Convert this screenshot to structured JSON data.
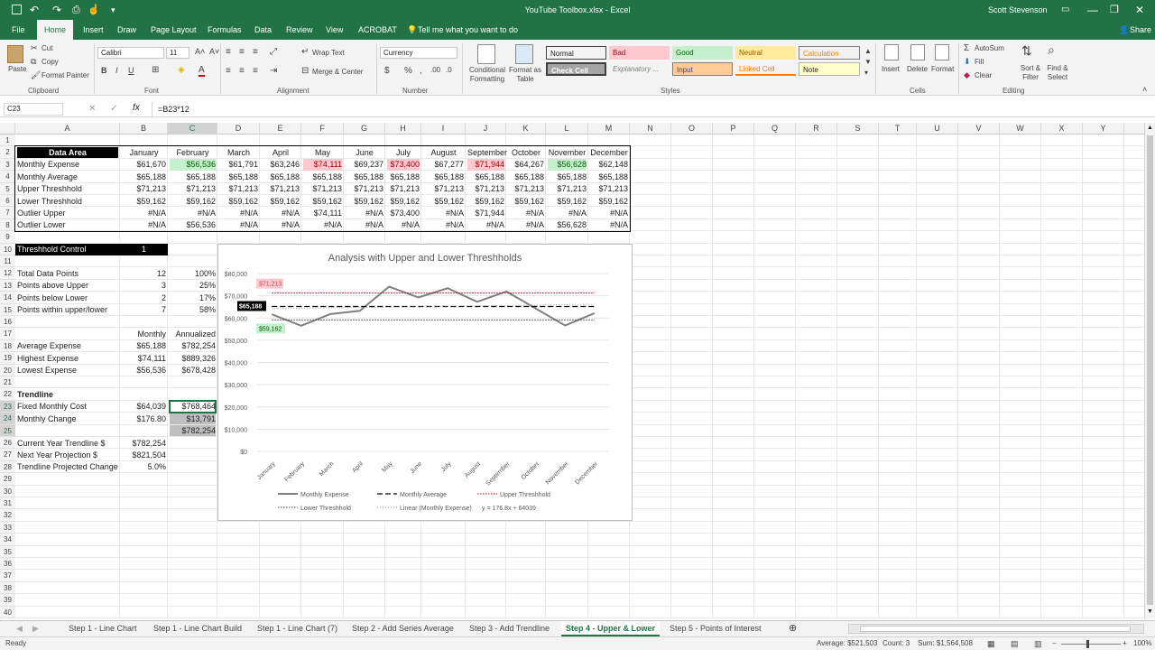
{
  "window": {
    "title": "YouTube Toolbox.xlsx - Excel",
    "user": "Scott Stevenson",
    "share": "Share"
  },
  "menu": [
    "File",
    "Home",
    "Insert",
    "Draw",
    "Page Layout",
    "Formulas",
    "Data",
    "Review",
    "View",
    "ACROBAT"
  ],
  "tellme": "Tell me what you want to do",
  "ribbon": {
    "paste": "Paste",
    "cut": "Cut",
    "copy": "Copy",
    "format_painter": "Format Painter",
    "font_name": "Calibri",
    "font_size": "11",
    "wrap_text": "Wrap Text",
    "merge_center": "Merge & Center",
    "number_format": "Currency",
    "cond_format": "Conditional Formatting",
    "format_table": "Format as Table",
    "styles": [
      {
        "label": "Normal",
        "bg": "#ffffff",
        "fg": "#222222"
      },
      {
        "label": "Bad",
        "bg": "#ffc7ce",
        "fg": "#9c0006"
      },
      {
        "label": "Good",
        "bg": "#c6efce",
        "fg": "#006100"
      },
      {
        "label": "Neutral",
        "bg": "#ffeb9c",
        "fg": "#9c5700"
      },
      {
        "label": "Calculation",
        "bg": "#f2f2f2",
        "fg": "#fa7d00"
      },
      {
        "label": "Check Cell",
        "bg": "#a5a5a5",
        "fg": "#ffffff"
      },
      {
        "label": "Explanatory ...",
        "bg": "#ffffff",
        "fg": "#7f7f7f"
      },
      {
        "label": "Input",
        "bg": "#ffcc99",
        "fg": "#3f3f76"
      },
      {
        "label": "Linked Cell",
        "bg": "#ffffff",
        "fg": "#fa7d00"
      },
      {
        "label": "Note",
        "bg": "#ffffcc",
        "fg": "#222222"
      }
    ],
    "cells": [
      "Insert",
      "Delete",
      "Format"
    ],
    "autosum": "AutoSum",
    "fill": "Fill",
    "clear": "Clear",
    "sort_filter": "Sort & Filter",
    "find_select": "Find & Select",
    "groups": [
      "Clipboard",
      "Font",
      "Alignment",
      "Number",
      "Styles",
      "Cells",
      "Editing"
    ]
  },
  "formula_bar": {
    "name_box": "C23",
    "formula": "=B23*12"
  },
  "columns": [
    "A",
    "B",
    "C",
    "D",
    "E",
    "F",
    "G",
    "H",
    "I",
    "J",
    "K",
    "L",
    "M",
    "N",
    "O",
    "P",
    "Q",
    "R",
    "S",
    "T",
    "U",
    "V",
    "W",
    "X",
    "Y"
  ],
  "rows": [
    "1",
    "2",
    "3",
    "4",
    "5",
    "6",
    "7",
    "8",
    "9",
    "10",
    "11",
    "12",
    "13",
    "14",
    "15",
    "16",
    "17",
    "18",
    "19",
    "20",
    "21",
    "22",
    "23",
    "24",
    "25",
    "26",
    "27",
    "28",
    "29",
    "30",
    "31",
    "32",
    "33",
    "34",
    "35",
    "36",
    "37",
    "38",
    "39",
    "40"
  ],
  "data_area": {
    "header": "Data Area",
    "months": [
      "January",
      "February",
      "March",
      "April",
      "May",
      "June",
      "July",
      "August",
      "September",
      "October",
      "November",
      "December"
    ],
    "rows": [
      {
        "label": "Monthly Expense",
        "values": [
          "$61,670",
          "$56,536",
          "$61,791",
          "$63,246",
          "$74,111",
          "$69,237",
          "$73,400",
          "$67,277",
          "$71,944",
          "$64,267",
          "$56,628",
          "$62,148"
        ]
      },
      {
        "label": "Monthly Average",
        "values": [
          "$65,188",
          "$65,188",
          "$65,188",
          "$65,188",
          "$65,188",
          "$65,188",
          "$65,188",
          "$65,188",
          "$65,188",
          "$65,188",
          "$65,188",
          "$65,188"
        ]
      },
      {
        "label": "Upper Threshhold",
        "values": [
          "$71,213",
          "$71,213",
          "$71,213",
          "$71,213",
          "$71,213",
          "$71,213",
          "$71,213",
          "$71,213",
          "$71,213",
          "$71,213",
          "$71,213",
          "$71,213"
        ]
      },
      {
        "label": "Lower Threshhold",
        "values": [
          "$59,162",
          "$59,162",
          "$59,162",
          "$59,162",
          "$59,162",
          "$59,162",
          "$59,162",
          "$59,162",
          "$59,162",
          "$59,162",
          "$59,162",
          "$59,162"
        ]
      },
      {
        "label": "Outlier Upper",
        "values": [
          "#N/A",
          "#N/A",
          "#N/A",
          "#N/A",
          "$74,111",
          "#N/A",
          "$73,400",
          "#N/A",
          "$71,944",
          "#N/A",
          "#N/A",
          "#N/A"
        ]
      },
      {
        "label": "Outlier Lower",
        "values": [
          "#N/A",
          "$56,536",
          "#N/A",
          "#N/A",
          "#N/A",
          "#N/A",
          "#N/A",
          "#N/A",
          "#N/A",
          "#N/A",
          "$56,628",
          "#N/A"
        ]
      }
    ]
  },
  "threshold": {
    "label": "Threshhold Control",
    "value": "1"
  },
  "stats": [
    {
      "label": "Total Data Points",
      "count": "12",
      "pct": "100%"
    },
    {
      "label": "Points above Upper",
      "count": "3",
      "pct": "25%"
    },
    {
      "label": "Points below Lower",
      "count": "2",
      "pct": "17%"
    },
    {
      "label": "Points within upper/lower",
      "count": "7",
      "pct": "58%"
    }
  ],
  "expense": {
    "h_monthly": "Monthly",
    "h_annual": "Annualized",
    "rows": [
      {
        "label": "Average Expense",
        "m": "$65,188",
        "a": "$782,254"
      },
      {
        "label": "Highest Expense",
        "m": "$74,111",
        "a": "$889,326"
      },
      {
        "label": "Lowest Expense",
        "m": "$56,536",
        "a": "$678,428"
      }
    ]
  },
  "trendline": {
    "title": "Trendline",
    "fixed_label": "Fixed Monthly Cost",
    "fixed_m": "$64,039",
    "fixed_a": "$768,464",
    "change_label": "Monthly Change",
    "change_m": "$176.80",
    "change_a": "$13,791",
    "total_a": "$782,254",
    "cur_label": "Current Year Trendline $",
    "cur_v": "$782,254",
    "next_label": "Next Year Projection $",
    "next_v": "$821,504",
    "proj_label": "Trendline Projected Change",
    "proj_v": "5.0%"
  },
  "chart_data": {
    "type": "line",
    "title": "Analysis with Upper and Lower Threshholds",
    "categories": [
      "January",
      "February",
      "March",
      "April",
      "May",
      "June",
      "July",
      "August",
      "September",
      "October",
      "November",
      "December"
    ],
    "ylim": [
      0,
      80000
    ],
    "yticks": [
      "$0",
      "$10,000",
      "$20,000",
      "$30,000",
      "$40,000",
      "$50,000",
      "$60,000",
      "$70,000",
      "$80,000"
    ],
    "series": [
      {
        "name": "Monthly Expense",
        "values": [
          61670,
          56536,
          61791,
          63246,
          74111,
          69237,
          73400,
          67277,
          71944,
          64267,
          56628,
          62148
        ],
        "color": "#7f7f7f"
      },
      {
        "name": "Monthly Average",
        "values": [
          65188,
          65188,
          65188,
          65188,
          65188,
          65188,
          65188,
          65188,
          65188,
          65188,
          65188,
          65188
        ],
        "color": "#000000"
      },
      {
        "name": "Upper Threshhold",
        "values": [
          71213,
          71213,
          71213,
          71213,
          71213,
          71213,
          71213,
          71213,
          71213,
          71213,
          71213,
          71213
        ],
        "color": "#c00000"
      },
      {
        "name": "Lower Threshhold",
        "values": [
          59162,
          59162,
          59162,
          59162,
          59162,
          59162,
          59162,
          59162,
          59162,
          59162,
          59162,
          59162
        ],
        "color": "#404040"
      }
    ],
    "trend_legend": "Linear (Monthly Expense)",
    "trend_equation": "y = 176.8x + 64039",
    "labels": {
      "upper": "$71,213",
      "avg": "$65,188",
      "lower": "$59,162"
    }
  },
  "sheet_tabs": [
    "Step 1 - Line Chart",
    "Step 1 - Line Chart Build",
    "Step 1 - Line Chart (7)",
    "Step 2 - Add Series Average",
    "Step 3 - Add Trendline",
    "Step 4 - Upper & Lower",
    "Step 5 - Points of Interest"
  ],
  "status": {
    "ready": "Ready",
    "average": "Average: $521,503",
    "count": "Count: 3",
    "sum": "Sum: $1,564,508",
    "zoom": "100%"
  }
}
